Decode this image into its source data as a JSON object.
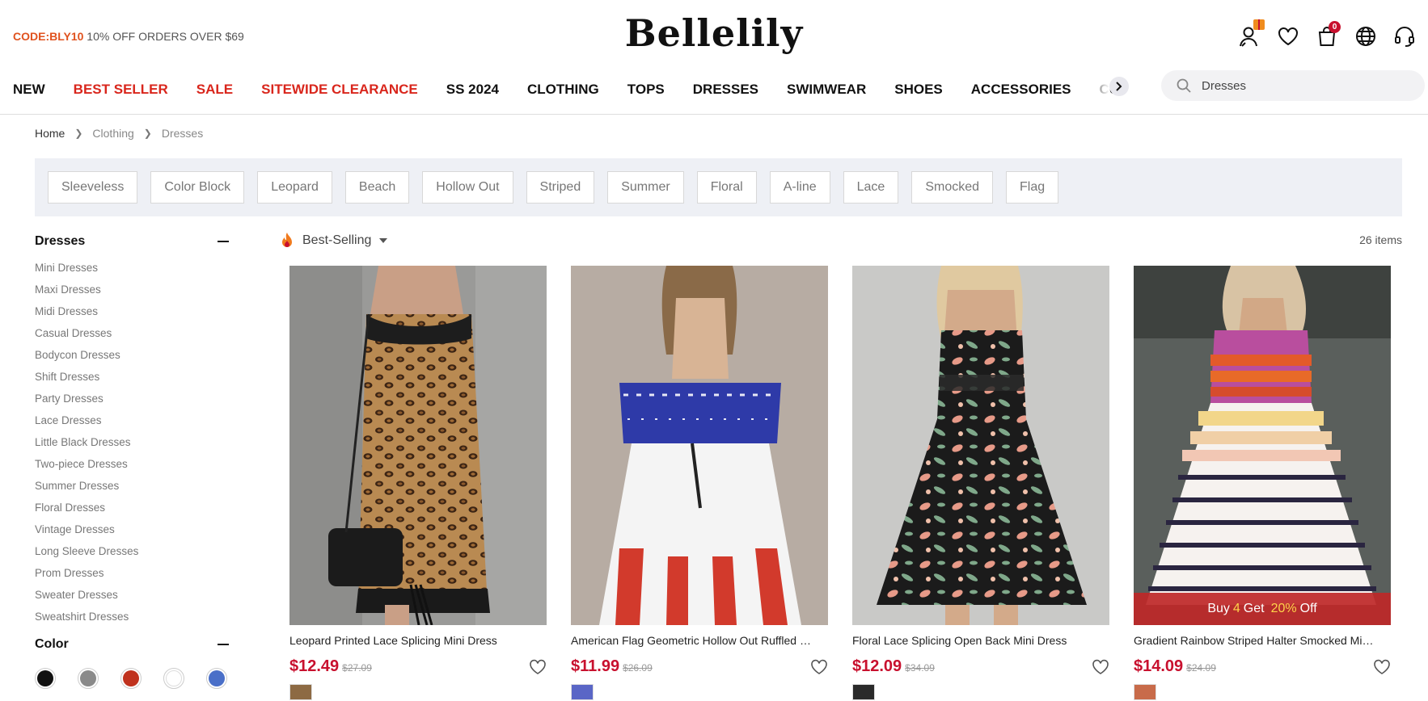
{
  "promo": {
    "code": "CODE:BLY10",
    "text": "10% OFF ORDERS OVER $69"
  },
  "logo": "Bellelily",
  "header_icons": {
    "cart_count": "0"
  },
  "nav": {
    "items": [
      {
        "label": "NEW",
        "highlight": false
      },
      {
        "label": "BEST SELLER",
        "highlight": true
      },
      {
        "label": "SALE",
        "highlight": true
      },
      {
        "label": "SITEWIDE CLEARANCE",
        "highlight": true
      },
      {
        "label": "SS 2024",
        "highlight": false
      },
      {
        "label": "CLOTHING",
        "highlight": false
      },
      {
        "label": "TOPS",
        "highlight": false
      },
      {
        "label": "DRESSES",
        "highlight": false
      },
      {
        "label": "SWIMWEAR",
        "highlight": false
      },
      {
        "label": "SHOES",
        "highlight": false
      },
      {
        "label": "ACCESSORIES",
        "highlight": false
      },
      {
        "label": "CURVE",
        "highlight": false
      }
    ],
    "highlight_color": "#d9261c"
  },
  "search": {
    "value": "Dresses",
    "placeholder": "Dresses"
  },
  "breadcrumb": {
    "home": "Home",
    "level1": "Clothing",
    "level2": "Dresses"
  },
  "tags": [
    "Sleeveless",
    "Color Block",
    "Leopard",
    "Beach",
    "Hollow Out",
    "Striped",
    "Summer",
    "Floral",
    "A-line",
    "Lace",
    "Smocked",
    "Flag"
  ],
  "sidebar": {
    "title": "Dresses",
    "links": [
      "Mini Dresses",
      "Maxi Dresses",
      "Midi Dresses",
      "Casual Dresses",
      "Bodycon Dresses",
      "Shift Dresses",
      "Party Dresses",
      "Lace Dresses",
      "Little Black Dresses",
      "Two-piece Dresses",
      "Summer Dresses",
      "Floral Dresses",
      "Vintage Dresses",
      "Long Sleeve Dresses",
      "Prom Dresses",
      "Sweater Dresses",
      "Sweatshirt Dresses"
    ],
    "color_title": "Color",
    "colors": [
      "#111111",
      "#8a8a8a",
      "#c0321e",
      "#ffffff",
      "#4a6fc8"
    ]
  },
  "sort": {
    "label": "Best-Selling"
  },
  "item_count": "26 items",
  "products": [
    {
      "title": "Leopard Printed Lace Splicing Mini Dress",
      "price": "$12.49",
      "old_price": "$27.09",
      "image": "leopard-dress"
    },
    {
      "title": "American Flag Geometric Hollow Out Ruffled Cold Shoulder Dress",
      "price": "$11.99",
      "old_price": "$26.09",
      "image": "flag-dress"
    },
    {
      "title": "Floral Lace Splicing Open Back Mini Dress",
      "price": "$12.09",
      "old_price": "$34.09",
      "image": "floral-dress"
    },
    {
      "title": "Gradient Rainbow Striped Halter Smocked Mini Dress",
      "price": "$14.09",
      "old_price": "$24.09",
      "image": "striped-dress",
      "promo": {
        "pre": "Buy",
        "qty": "4",
        "mid": "Get",
        "pct": "20%",
        "post": "Off"
      }
    }
  ]
}
